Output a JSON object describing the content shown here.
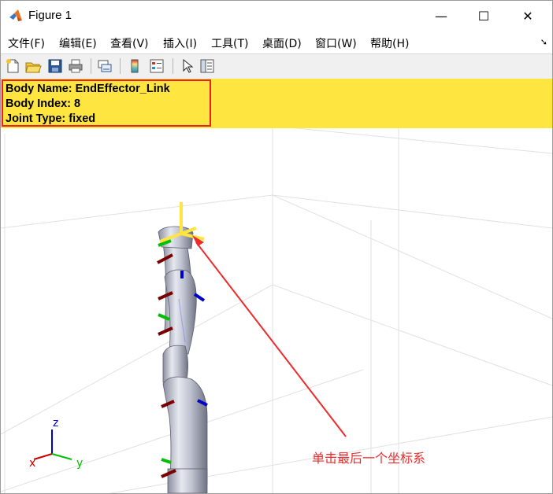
{
  "window": {
    "title": "Figure 1"
  },
  "window_controls": {
    "minimize": "—",
    "maximize": "☐",
    "close": "✕"
  },
  "menus": [
    {
      "label": "文件(F)"
    },
    {
      "label": "编辑(E)"
    },
    {
      "label": "查看(V)"
    },
    {
      "label": "插入(I)"
    },
    {
      "label": "工具(T)"
    },
    {
      "label": "桌面(D)"
    },
    {
      "label": "窗口(W)"
    },
    {
      "label": "帮助(H)"
    }
  ],
  "toolbar_icons": [
    "new-figure-icon",
    "open-file-icon",
    "save-icon",
    "print-icon",
    "link-plot-icon",
    "insert-colorbar-icon",
    "insert-legend-icon",
    "pointer-icon",
    "property-inspector-icon"
  ],
  "info": {
    "body_name": "Body Name: EndEffector_Link",
    "body_index": "Body Index: 8",
    "joint_type": "Joint Type: fixed"
  },
  "axes_triad": {
    "x": "x",
    "y": "y",
    "z": "z"
  },
  "annotation": "单击最后一个坐标系",
  "colors": {
    "banner": "#ffe53f",
    "highlight": "#e7202a",
    "annotation": "#ee2a2a"
  }
}
